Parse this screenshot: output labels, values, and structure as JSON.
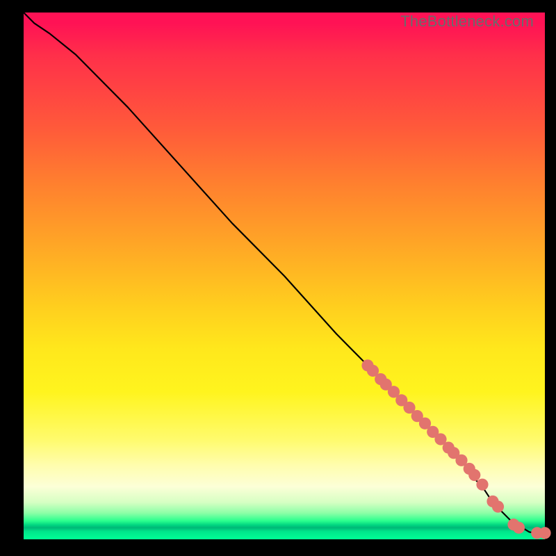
{
  "watermark": "TheBottleneck.com",
  "colors": {
    "dot": "#e2746e",
    "curve": "#000000",
    "background": "#000000"
  },
  "chart_data": {
    "type": "line",
    "title": "",
    "xlabel": "",
    "ylabel": "",
    "xlim": [
      0,
      100
    ],
    "ylim": [
      0,
      100
    ],
    "series": [
      {
        "name": "curve",
        "x": [
          0,
          2,
          5,
          10,
          20,
          30,
          40,
          50,
          60,
          66,
          68,
          70,
          72,
          74,
          76,
          78,
          80,
          82,
          84,
          86,
          88,
          90,
          92,
          94,
          96,
          97,
          98,
          100
        ],
        "y": [
          100,
          98,
          96,
          92,
          82,
          71,
          60,
          50,
          39,
          33,
          31,
          29,
          27,
          25,
          23,
          21,
          19,
          17,
          15,
          12,
          10,
          7,
          5,
          3,
          2,
          1.4,
          1.2,
          1.2
        ]
      }
    ],
    "points": {
      "name": "highlight-dots",
      "comment": "red dots clustered along the lower-right tail of the curve",
      "x": [
        66,
        67,
        68.5,
        69.5,
        71,
        72.5,
        74,
        75.5,
        77,
        78.5,
        80,
        81.5,
        82.5,
        84,
        85.5,
        86.5,
        88,
        90,
        91,
        94,
        95,
        98.5,
        100
      ],
      "y": [
        33,
        32,
        30.4,
        29.4,
        28,
        26.4,
        25,
        23.4,
        22,
        20.4,
        19,
        17.4,
        16.4,
        15,
        13.4,
        12.2,
        10.4,
        7.2,
        6.2,
        2.8,
        2.2,
        1.2,
        1.2
      ]
    }
  }
}
